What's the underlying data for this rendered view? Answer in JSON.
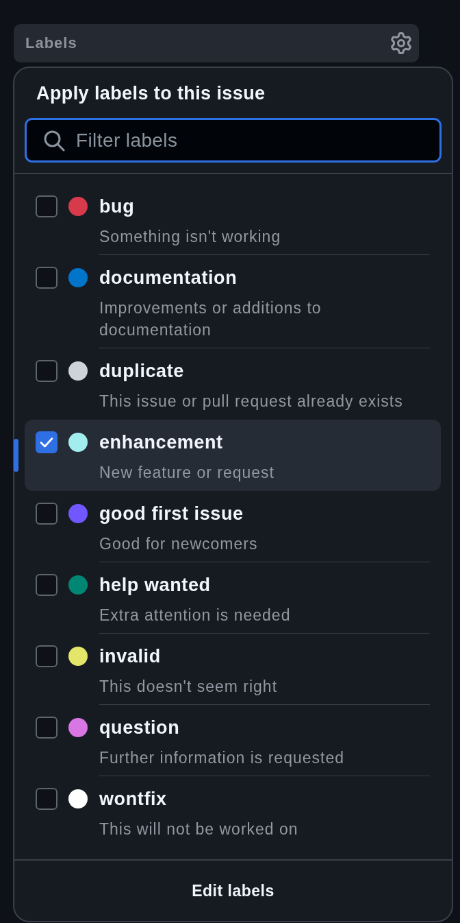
{
  "header": {
    "title": "Labels"
  },
  "popover": {
    "title": "Apply labels to this issue",
    "search": {
      "placeholder": "Filter labels"
    },
    "labels": [
      {
        "name": "bug",
        "description": "Something isn't working",
        "color": "#d73a4a",
        "checked": false,
        "active": false
      },
      {
        "name": "documentation",
        "description": "Improvements or additions to documentation",
        "color": "#0075ca",
        "checked": false,
        "active": false
      },
      {
        "name": "duplicate",
        "description": "This issue or pull request already exists",
        "color": "#cfd3d7",
        "checked": false,
        "active": false
      },
      {
        "name": "enhancement",
        "description": "New feature or request",
        "color": "#a2eeef",
        "checked": true,
        "active": true
      },
      {
        "name": "good first issue",
        "description": "Good for newcomers",
        "color": "#7057ff",
        "checked": false,
        "active": false
      },
      {
        "name": "help wanted",
        "description": "Extra attention is needed",
        "color": "#008672",
        "checked": false,
        "active": false
      },
      {
        "name": "invalid",
        "description": "This doesn't seem right",
        "color": "#e4e669",
        "checked": false,
        "active": false
      },
      {
        "name": "question",
        "description": "Further information is requested",
        "color": "#d876e3",
        "checked": false,
        "active": false
      },
      {
        "name": "wontfix",
        "description": "This will not be worked on",
        "color": "#ffffff",
        "checked": false,
        "active": false
      }
    ],
    "footer_button": "Edit labels"
  }
}
